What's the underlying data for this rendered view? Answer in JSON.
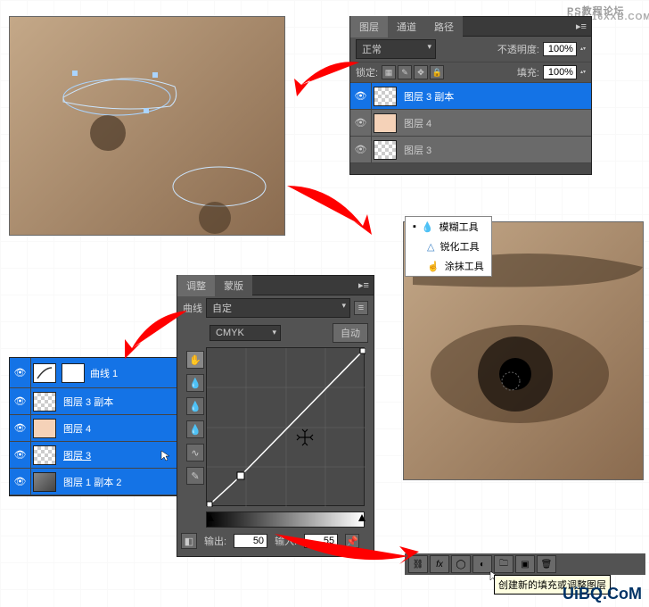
{
  "watermark": {
    "line1": "PS教程论坛",
    "line2": "BBS.16XXB.COM"
  },
  "uibq": "UiBQ.CoM",
  "layers_panel": {
    "tabs": [
      "图层",
      "通道",
      "路径"
    ],
    "blend_label": "正常",
    "opacity_label": "不透明度:",
    "opacity_value": "100%",
    "lock_label": "锁定:",
    "fill_label": "填充:",
    "fill_value": "100%",
    "items": [
      {
        "name": "图层 3 副本",
        "thumb": "checker",
        "selected": true
      },
      {
        "name": "图层 4",
        "thumb": "peach",
        "selected": false
      },
      {
        "name": "图层 3",
        "thumb": "checker",
        "selected": false
      }
    ]
  },
  "layers_panel2": {
    "items": [
      {
        "name": "曲线 1",
        "thumb": "curves",
        "mask": true
      },
      {
        "name": "图层 3 副本",
        "thumb": "checker"
      },
      {
        "name": "图层 4",
        "thumb": "peach"
      },
      {
        "name": "图层 3",
        "thumb": "checker",
        "underline": true
      },
      {
        "name": "图层 1 副本 2",
        "thumb": "img"
      }
    ]
  },
  "adjust_panel": {
    "tabs": [
      "调整",
      "蒙版"
    ],
    "type_label": "曲线",
    "preset": "自定",
    "channel": "CMYK",
    "auto": "自动",
    "output_label": "输出:",
    "output_value": "50",
    "input_label": "输入:",
    "input_value": "55"
  },
  "tool_tip": {
    "items": [
      {
        "name": "模糊工具",
        "icon": "droplet"
      },
      {
        "name": "锐化工具",
        "icon": "triangle",
        "sel": true
      },
      {
        "name": "涂抹工具",
        "icon": "finger"
      }
    ]
  },
  "status_tooltip": "创建新的填充或调整图层",
  "chart_data": {
    "type": "line",
    "title": "曲线",
    "xlabel": "输入",
    "ylabel": "输出",
    "xlim": [
      0,
      255
    ],
    "ylim": [
      0,
      255
    ],
    "series": [
      {
        "name": "CMYK",
        "x": [
          0,
          55,
          255
        ],
        "y": [
          0,
          50,
          255
        ]
      }
    ],
    "annotations": {
      "output": 50,
      "input": 55
    }
  }
}
